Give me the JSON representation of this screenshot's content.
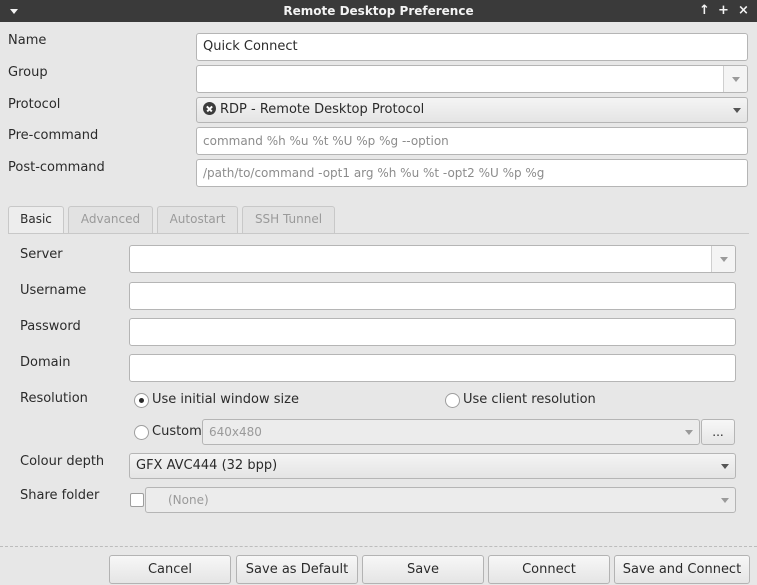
{
  "window": {
    "title": "Remote Desktop Preference",
    "controls": [
      "↑",
      "+",
      "×"
    ]
  },
  "profile": {
    "name_label": "Name",
    "name_value": "Quick Connect",
    "group_label": "Group",
    "group_value": "",
    "protocol_label": "Protocol",
    "protocol_value": "RDP - Remote Desktop Protocol",
    "precommand_label": "Pre-command",
    "precommand_placeholder": "command %h %u %t %U %p %g --option",
    "postcommand_label": "Post-command",
    "postcommand_placeholder": "/path/to/command -opt1 arg %h %u %t -opt2 %U %p %g"
  },
  "tabs": [
    {
      "label": "Basic",
      "active": true
    },
    {
      "label": "Advanced",
      "active": false
    },
    {
      "label": "Autostart",
      "active": false
    },
    {
      "label": "SSH Tunnel",
      "active": false
    }
  ],
  "basic": {
    "server_label": "Server",
    "server_value": "",
    "username_label": "Username",
    "password_label": "Password",
    "domain_label": "Domain",
    "resolution_label": "Resolution",
    "resolution_options": {
      "initial": "Use initial window size",
      "client": "Use client resolution",
      "custom": "Custom"
    },
    "resolution_selected": "initial",
    "custom_resolution_value": "640x480",
    "custom_more_label": "...",
    "colour_depth_label": "Colour depth",
    "colour_depth_value": "GFX AVC444 (32 bpp)",
    "share_folder_label": "Share folder",
    "share_folder_value": "(None)"
  },
  "actions": {
    "cancel": "Cancel",
    "save_default": "Save as Default",
    "save": "Save",
    "connect": "Connect",
    "save_connect": "Save and Connect"
  }
}
